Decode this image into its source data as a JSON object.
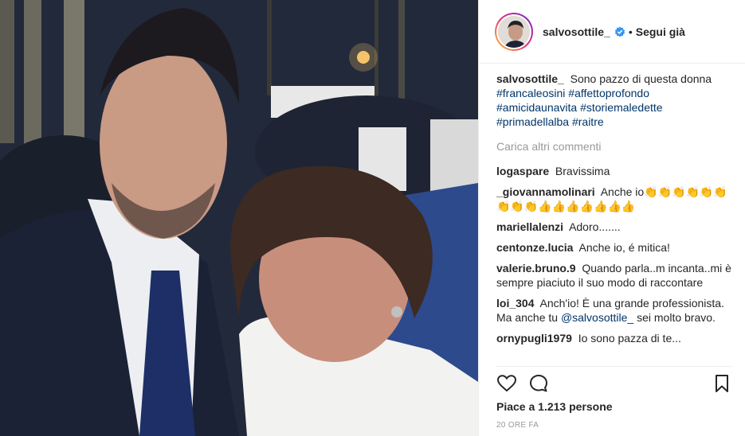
{
  "post": {
    "username": "salvosottile_",
    "verified": true,
    "follow_separator": "•",
    "follow_label": "Segui già",
    "caption": {
      "username": "salvosottile_",
      "text": "Sono pazzo di questa donna",
      "hashtags": [
        "#francaleosini",
        "#affettoprofondo",
        "#amicidaunavita",
        "#storiemaledette",
        "#primadellalba",
        "#raitre"
      ]
    },
    "load_more": "Carica altri commenti",
    "comments": [
      {
        "user": "logaspare",
        "text": "Bravissima"
      },
      {
        "user": "_giovannamolinari",
        "text": "Anche io👏👏👏👏👏👏👏👏👏👍👍👍👍👍👍👍"
      },
      {
        "user": "mariellalenzi",
        "text": "Adoro......."
      },
      {
        "user": "centonze.lucia",
        "text": "Anche io, é mitica!"
      },
      {
        "user": "valerie.bruno.9",
        "text": "Quando parla..m incanta..mi è sempre piaciuto il suo modo di raccontare"
      },
      {
        "user": "loi_304",
        "text_before": "Anch'io! È una grande professionista. Ma anche tu ",
        "mention": "@salvosottile_",
        "text_after": " sei molto bravo."
      },
      {
        "user": "ornypugli1979",
        "text": "Io sono pazza di te..."
      }
    ],
    "likes": "Piace a 1.213 persone",
    "time": "20 ORE FA"
  },
  "icons": {
    "like": "heart-icon",
    "comment": "comment-icon",
    "save": "bookmark-icon",
    "verified": "verified-badge-icon"
  },
  "colors": {
    "link": "#003569",
    "verified": "#3897f0",
    "muted": "#999999",
    "text": "#262626"
  }
}
